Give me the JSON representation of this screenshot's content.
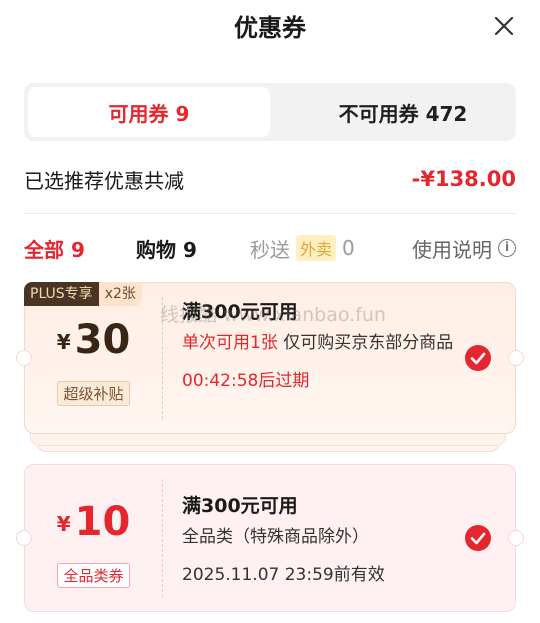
{
  "header": {
    "title": "优惠券",
    "close_icon": "close-icon"
  },
  "tabs": {
    "available": "可用券 9",
    "unavailable": "不可用券 472"
  },
  "summary": {
    "label": "已选推荐优惠共减",
    "amount": "-¥138.00"
  },
  "filters": {
    "all": "全部 9",
    "shopping": "购物 9",
    "flash_prefix": "秒送",
    "flash_tag": "外卖",
    "flash_count": "0",
    "help": "使用说明",
    "help_icon_glyph": "i"
  },
  "coupons": [
    {
      "badge": "PLUS专享",
      "count": "x2张",
      "currency": "¥",
      "value": "30",
      "tag": "超级补贴",
      "title": "满300元可用",
      "desc_red": "单次可用1张",
      "desc": " 仅可购买京东部分商品",
      "expire": "00:42:58后过期",
      "selected": true
    },
    {
      "currency": "¥",
      "value": "10",
      "tag": "全品类券",
      "title": "满300元可用",
      "desc": "全品类（特殊商品除外）",
      "expire": "2025.11.07 23:59前有效",
      "selected": true
    }
  ],
  "watermark": "线报酷 www.xianbao.fun",
  "colors": {
    "accent": "#e4262f",
    "plus_dark": "#4a3424"
  }
}
